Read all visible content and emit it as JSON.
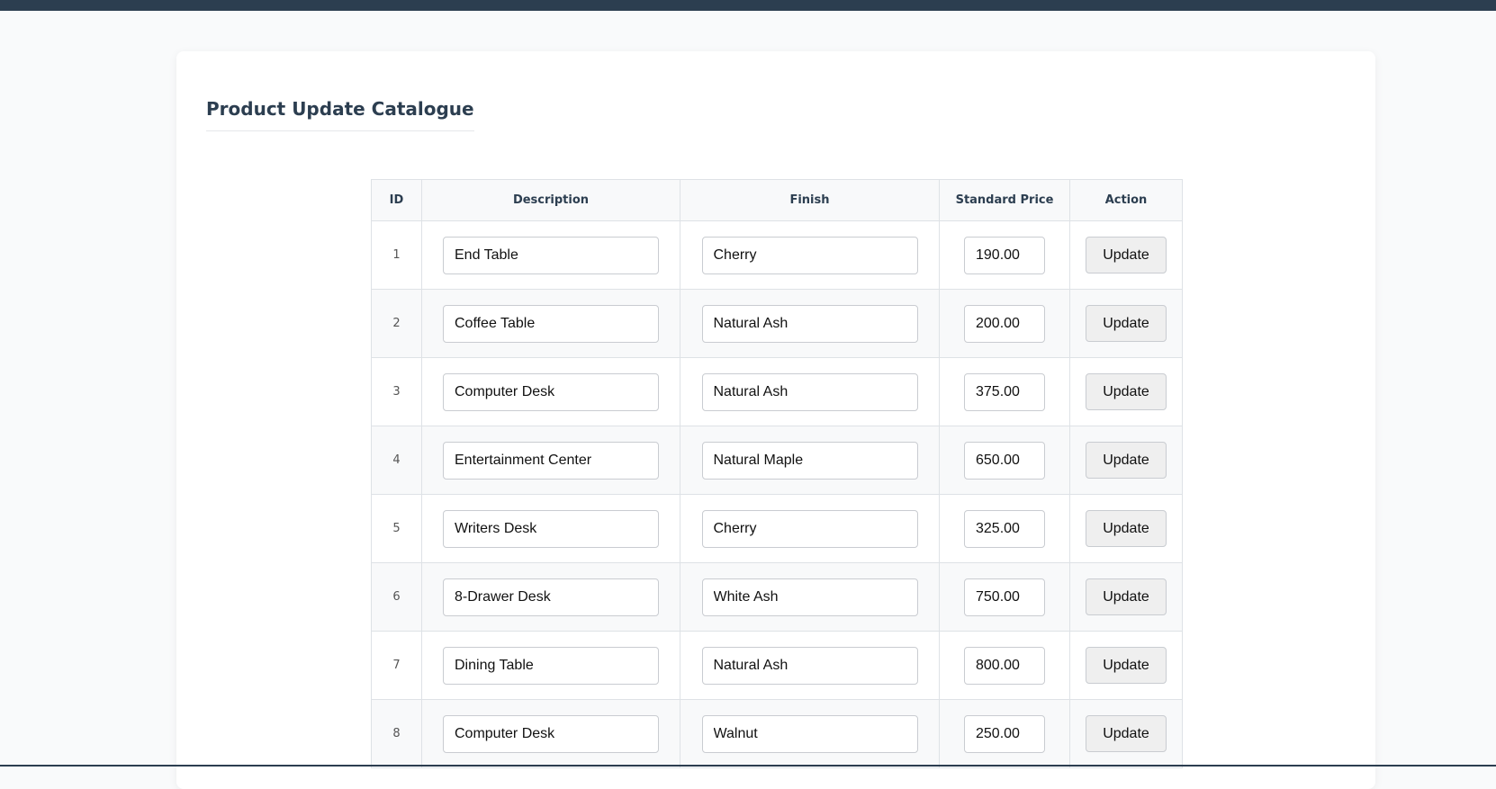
{
  "page": {
    "title": "Product Update Catalogue"
  },
  "table": {
    "headers": {
      "id": "ID",
      "description": "Description",
      "finish": "Finish",
      "price": "Standard Price",
      "action": "Action"
    },
    "rows": [
      {
        "id": "1",
        "description": "End Table",
        "finish": "Cherry",
        "price": "190.00",
        "action": "Update"
      },
      {
        "id": "2",
        "description": "Coffee Table",
        "finish": "Natural Ash",
        "price": "200.00",
        "action": "Update"
      },
      {
        "id": "3",
        "description": "Computer Desk",
        "finish": "Natural Ash",
        "price": "375.00",
        "action": "Update"
      },
      {
        "id": "4",
        "description": "Entertainment Center",
        "finish": "Natural Maple",
        "price": "650.00",
        "action": "Update"
      },
      {
        "id": "5",
        "description": "Writers Desk",
        "finish": "Cherry",
        "price": "325.00",
        "action": "Update"
      },
      {
        "id": "6",
        "description": "8-Drawer Desk",
        "finish": "White Ash",
        "price": "750.00",
        "action": "Update"
      },
      {
        "id": "7",
        "description": "Dining Table",
        "finish": "Natural Ash",
        "price": "800.00",
        "action": "Update"
      },
      {
        "id": "8",
        "description": "Computer Desk",
        "finish": "Walnut",
        "price": "250.00",
        "action": "Update"
      }
    ]
  },
  "colors": {
    "header_bar": "#2c3e50",
    "title": "#2c3e50",
    "stripe": "#f8f9fa",
    "border": "#dee2e6"
  }
}
